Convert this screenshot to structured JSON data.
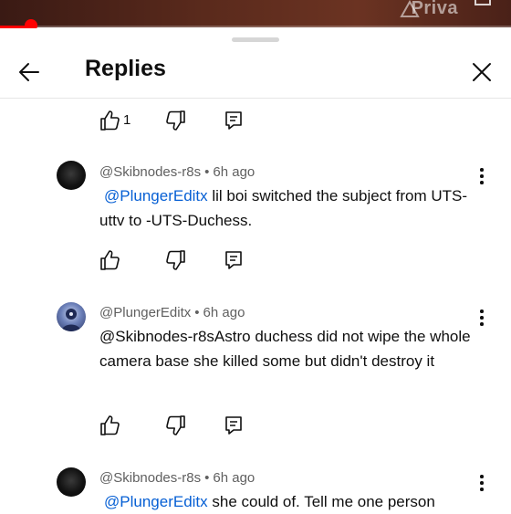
{
  "video": {
    "overlay_label": "Priva",
    "progress_fraction": 0.06
  },
  "panel": {
    "title": "Replies"
  },
  "icons": {
    "back": "back-arrow-icon",
    "close": "close-icon",
    "like": "thumbs-up-icon",
    "dislike": "thumbs-down-icon",
    "reply": "reply-comment-icon",
    "more": "more-vert-icon"
  },
  "colors": {
    "accent": "#ff0000",
    "mention": "#065fd4",
    "meta": "#606060"
  },
  "prev_actions": {
    "like_count": "1"
  },
  "comments": [
    {
      "author": "@Skibnodes-r8s",
      "separator": "•",
      "time": "6h ago",
      "mention": "@PlungerEditx",
      "text": " lil boi switched the subject from UTS-uttv to -UTS-Duchess."
    },
    {
      "author": "@PlungerEditx",
      "separator": "•",
      "time": "6h ago",
      "mention": "",
      "text": "@Skibnodes-r8sAstro duchess did not wipe the whole camera base she killed some but didn't destroy it"
    },
    {
      "author": "@Skibnodes-r8s",
      "separator": "•",
      "time": "6h ago",
      "mention": "@PlungerEditx",
      "text": " she could of. Tell me one person"
    }
  ]
}
